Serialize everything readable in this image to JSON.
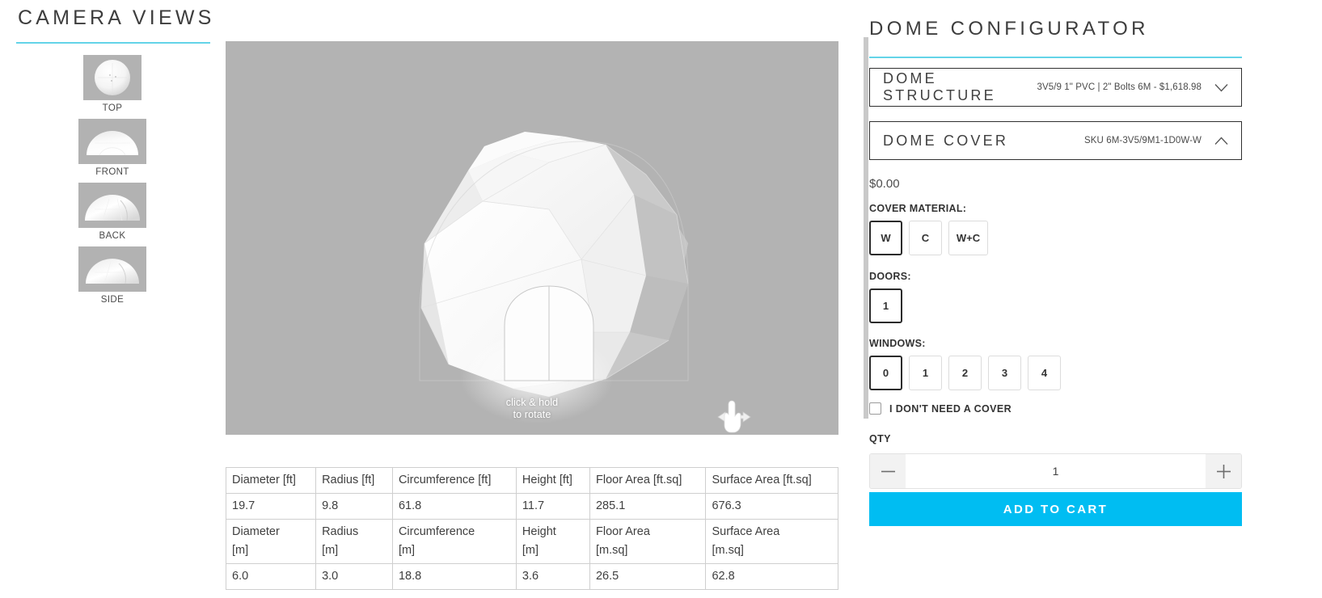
{
  "camera": {
    "title": "CAMERA VIEWS",
    "accent": "#63d4e8",
    "views": [
      {
        "label": "TOP",
        "icon": "dome-top-view-thumbnail"
      },
      {
        "label": "FRONT",
        "icon": "dome-front-view-thumbnail"
      },
      {
        "label": "BACK",
        "icon": "dome-back-view-thumbnail"
      },
      {
        "label": "SIDE",
        "icon": "dome-side-view-thumbnail"
      }
    ]
  },
  "viewport": {
    "hint_line1": "click & hold",
    "hint_line2": "to rotate",
    "cursor_icon": "pointing-hand-rotate-cursor",
    "background": "#b3b3b3"
  },
  "specs": {
    "imperial_headers": [
      "Diameter [ft]",
      "Radius [ft]",
      "Circumference [ft]",
      "Height [ft]",
      "Floor Area [ft.sq]",
      "Surface Area [ft.sq]"
    ],
    "imperial_values": [
      "19.7",
      "9.8",
      "61.8",
      "11.7",
      "285.1",
      "676.3"
    ],
    "metric_headers": [
      "Diameter\n[m]",
      "Radius\n[m]",
      "Circumference\n[m]",
      "Height\n[m]",
      "Floor Area\n[m.sq]",
      "Surface Area\n[m.sq]"
    ],
    "metric_values": [
      "6.0",
      "3.0",
      "18.8",
      "3.6",
      "26.5",
      "62.8"
    ]
  },
  "config": {
    "title": "DOME CONFIGURATOR",
    "accent": "#63d4e8",
    "accordions": [
      {
        "label": "DOME STRUCTURE",
        "summary": "3V5/9 1\" PVC | 2\" Bolts 6M - $1,618.98",
        "state": "collapsed",
        "icon": "chevron-down-icon"
      },
      {
        "label": "DOME COVER",
        "summary": "SKU 6M-3V5/9M1-1D0W-W",
        "state": "expanded",
        "icon": "chevron-up-icon"
      }
    ],
    "price": "$0.00",
    "cover_material": {
      "label": "COVER MATERIAL:",
      "options": [
        "W",
        "C",
        "W+C"
      ],
      "selected": "W"
    },
    "doors": {
      "label": "DOORS:",
      "options": [
        "1"
      ],
      "selected": "1"
    },
    "windows": {
      "label": "WINDOWS:",
      "options": [
        "0",
        "1",
        "2",
        "3",
        "4"
      ],
      "selected": "0"
    },
    "no_cover": {
      "label": "I DON'T NEED A COVER",
      "checked": false
    },
    "qty": {
      "label": "QTY",
      "value": "1",
      "decrement_icon": "minus-icon",
      "increment_icon": "plus-icon"
    },
    "add_to_cart": "ADD TO CART",
    "add_to_cart_color": "#00bdf2"
  }
}
